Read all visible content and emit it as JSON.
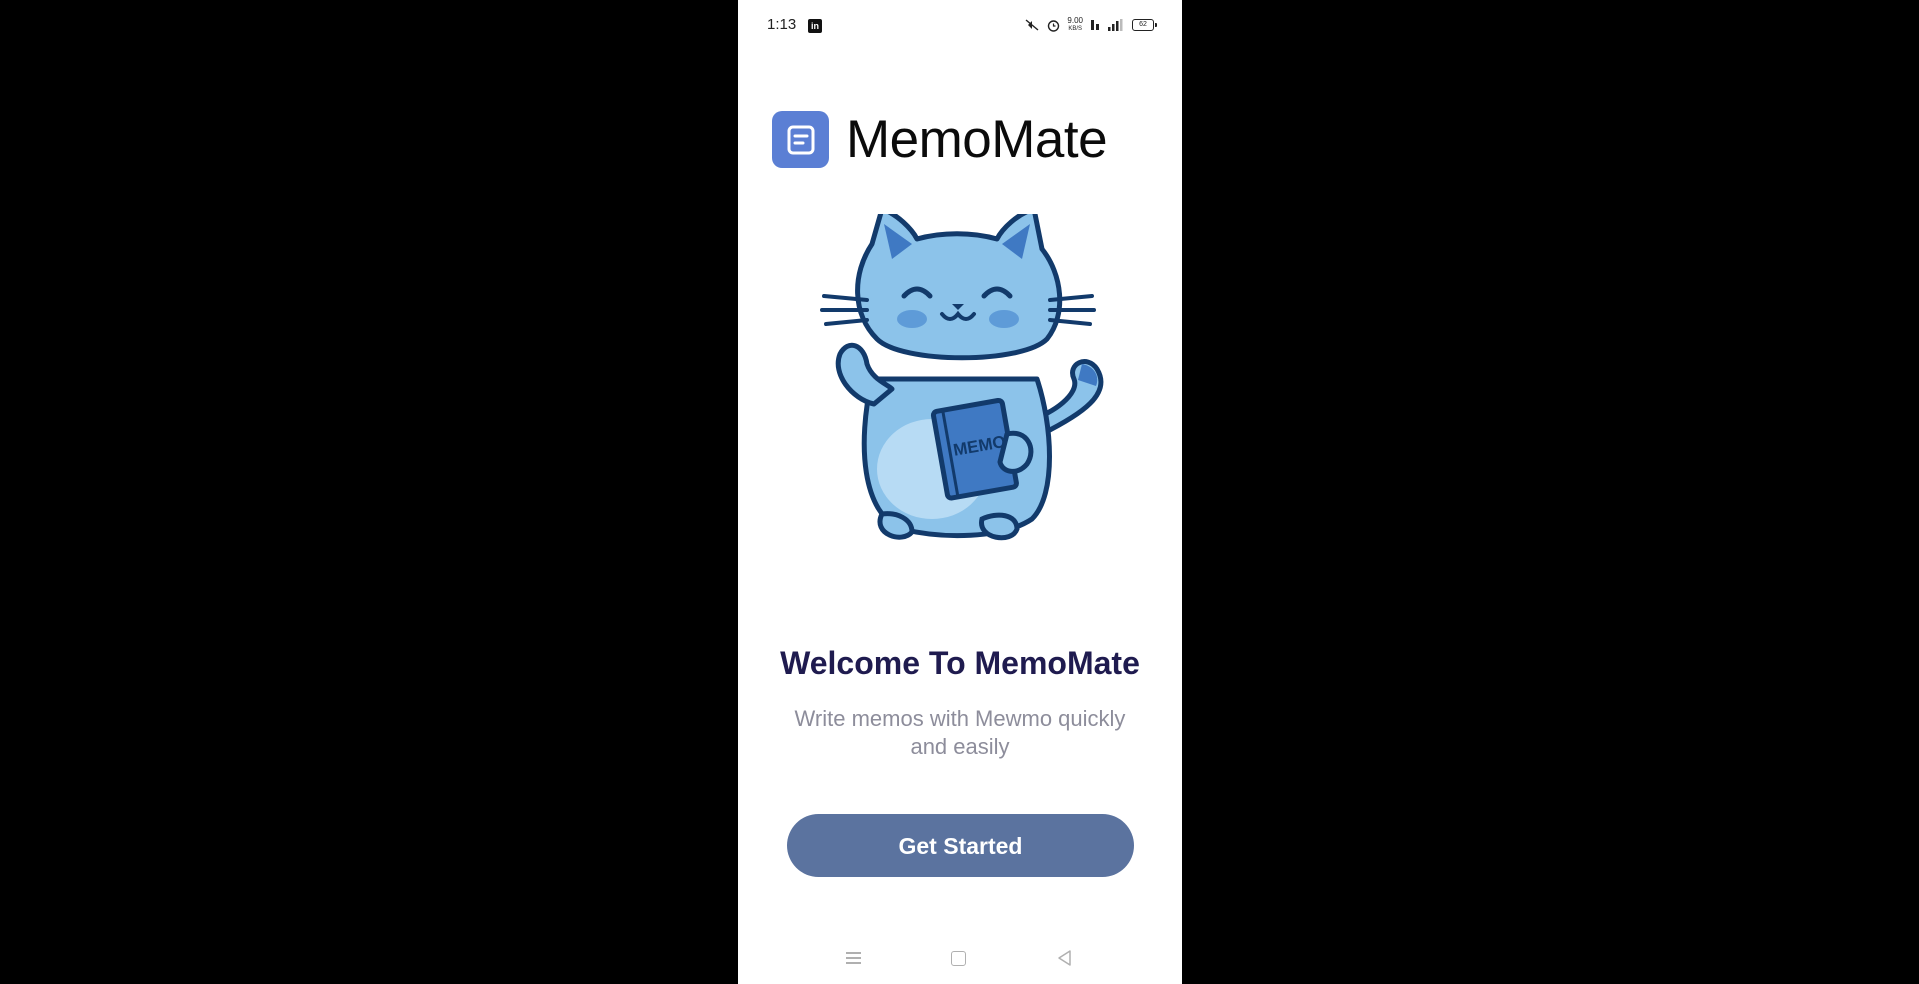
{
  "status_bar": {
    "time": "1:13",
    "app_notification": "in",
    "net_speed_value": "9.00",
    "net_speed_unit": "KB/S",
    "battery_level": "62"
  },
  "app": {
    "title": "MemoMate"
  },
  "mascot": {
    "book_label": "MEMO"
  },
  "welcome": {
    "title": "Welcome To MemoMate",
    "subtitle": "Write memos with Mewmo quickly and easily"
  },
  "actions": {
    "get_started_label": "Get Started"
  },
  "colors": {
    "brand_logo": "#5b7fd4",
    "button": "#5b739f",
    "title_text": "#1f1b4f",
    "subtitle_text": "#8d8d9b"
  }
}
